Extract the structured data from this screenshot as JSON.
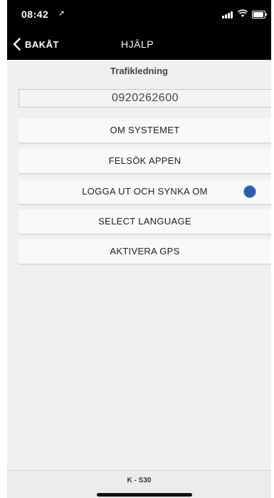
{
  "status": {
    "time": "08:42"
  },
  "nav": {
    "back_label": "BAKÅT",
    "title": "HJÄLP"
  },
  "main": {
    "heading": "Trafikledning",
    "phone_number": "0920262600",
    "buttons": [
      {
        "label": "OM SYSTEMET"
      },
      {
        "label": "FELSÖK APPEN"
      },
      {
        "label": "LOGGA UT OCH SYNKA OM",
        "indicator_color": "#2f5ba7"
      },
      {
        "label": "SELECT LANGUAGE"
      },
      {
        "label": "AKTIVERA GPS"
      }
    ]
  },
  "footer": {
    "version": "K - S30"
  }
}
